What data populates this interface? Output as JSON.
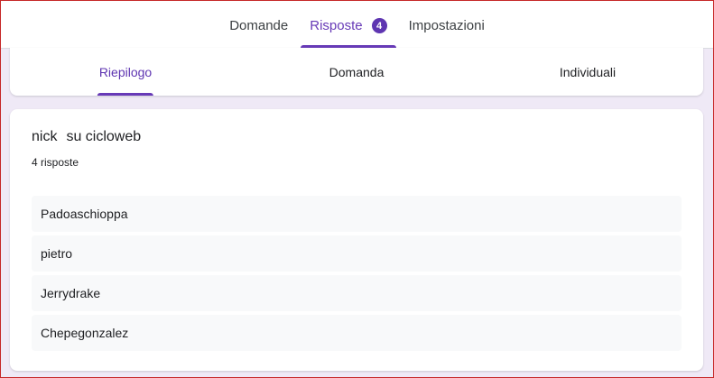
{
  "top_tabs": [
    {
      "label": "Domande"
    },
    {
      "label": "Risposte",
      "badge": "4"
    },
    {
      "label": "Impostazioni"
    }
  ],
  "sub_tabs": [
    {
      "label": "Riepilogo"
    },
    {
      "label": "Domanda"
    },
    {
      "label": "Individuali"
    }
  ],
  "question": {
    "title_part1": "nick",
    "title_part2": "su cicloweb",
    "count": "4 risposte",
    "answers": [
      "Padoaschioppa",
      "pietro",
      "Jerrydrake",
      "Chepegonzalez"
    ]
  },
  "colors": {
    "accent": "#673ab7",
    "background": "#efe9f6",
    "answer_bg": "#f8f9fa"
  }
}
